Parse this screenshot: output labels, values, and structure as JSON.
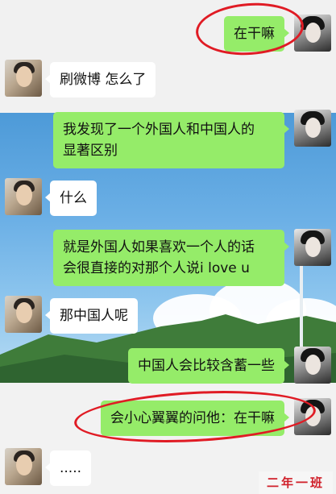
{
  "messages": [
    {
      "side": "right",
      "text": "在干嘛"
    },
    {
      "side": "left",
      "text": "刷微博 怎么了"
    },
    {
      "side": "right",
      "lines": [
        "我发现了一个外国人和中国人的",
        "显著区别"
      ]
    },
    {
      "side": "left",
      "text": "什么"
    },
    {
      "side": "right",
      "lines": [
        "就是外国人如果喜欢一个人的话",
        "会很直接的对那个人说i love u"
      ]
    },
    {
      "side": "left",
      "text": "那中国人呢"
    },
    {
      "side": "right",
      "text": "中国人会比较含蓄一些"
    },
    {
      "side": "right",
      "text": "会小心翼翼的问他：在干嘛"
    },
    {
      "side": "left",
      "text": "....."
    }
  ],
  "watermark": "二年一班",
  "colors": {
    "sent_bubble": "#95ec69",
    "received_bubble": "#ffffff",
    "highlight_ring": "#e01b24"
  }
}
